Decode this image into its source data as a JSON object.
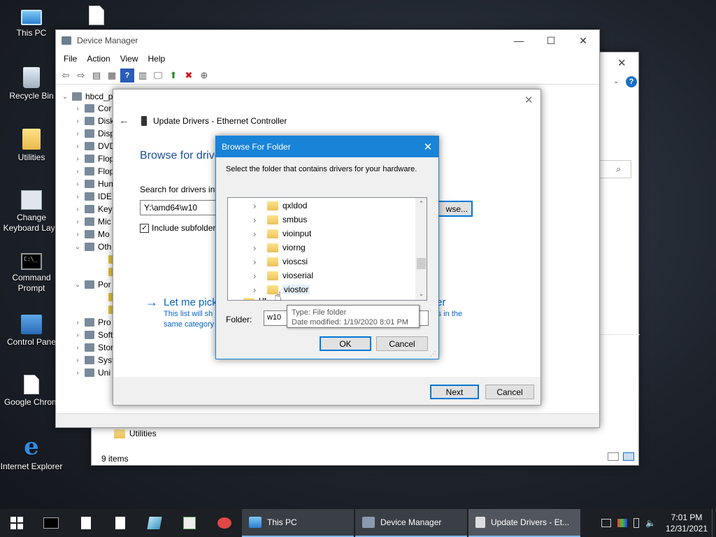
{
  "desktop": {
    "icons": [
      {
        "label": "This PC",
        "icon": "computer-icon"
      },
      {
        "label": "",
        "icon": "file-icon"
      },
      {
        "label": "Recycle Bin",
        "icon": "recycle-bin-icon"
      },
      {
        "label": "Utilities",
        "icon": "folder-icon"
      },
      {
        "label": "Change Keyboard Layo",
        "icon": "keyboard-icon"
      },
      {
        "label": "Command Prompt",
        "icon": "command-prompt-icon"
      },
      {
        "label": "Control Pane",
        "icon": "control-panel-icon"
      },
      {
        "label": "Google Chrom",
        "icon": "file-icon"
      },
      {
        "label": "Internet Explorer",
        "icon": "internet-explorer-icon"
      }
    ]
  },
  "explorer_bg": {
    "item_label": "Utilities",
    "status": "9 items"
  },
  "device_manager": {
    "title": "Device Manager",
    "menu": [
      "File",
      "Action",
      "View",
      "Help"
    ],
    "root": "hbcd_p",
    "tree": [
      "Cor",
      "Disk",
      "Disp",
      "DVD",
      "Flop",
      "Flop",
      "Hum",
      "IDE",
      "Key",
      "Mic",
      "Mo",
      "Oth",
      "",
      "",
      "Por",
      "",
      "",
      "Pro",
      "Soft",
      "Stor",
      "Syst",
      "Uni"
    ]
  },
  "wizard": {
    "title": "Update Drivers - Ethernet Controller",
    "heading": "Browse for drive",
    "search_label": "Search for drivers in t",
    "path_value": "Y:\\amd64\\w10",
    "browse_label": "wse...",
    "include_subfolders": "Include subfolder",
    "pick_link": "Let me pick",
    "pick_link_tail": "er",
    "pick_desc_1": "This list will sh",
    "pick_desc_1_tail": "rs in the",
    "pick_desc_2": "same category",
    "next": "Next",
    "cancel": "Cancel"
  },
  "browse_folder": {
    "title": "Browse For Folder",
    "instruction": "Select the folder that contains drivers for your hardware.",
    "folders": [
      "qxldod",
      "smbus",
      "vioinput",
      "viorng",
      "vioscsi",
      "vioserial",
      "viostor"
    ],
    "partial_row": "Ut",
    "tooltip_type": "Type: File folder",
    "tooltip_modified": "Date modified: 1/19/2020 8:01 PM",
    "folder_label": "Folder:",
    "folder_value": "w10",
    "ok": "OK",
    "cancel": "Cancel"
  },
  "taskbar": {
    "apps": [
      "This PC",
      "Device Manager",
      "Update Drivers - Et..."
    ],
    "time": "7:01 PM",
    "date": "12/31/2021"
  }
}
